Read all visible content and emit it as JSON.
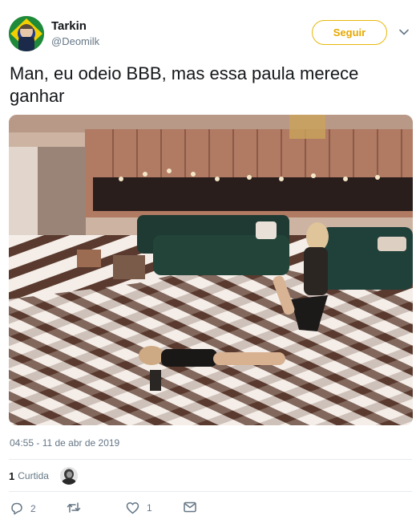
{
  "author": {
    "name": "Tarkin",
    "handle": "@Deomilk"
  },
  "follow_button": {
    "label": "Seguir",
    "color": "#e6a800"
  },
  "tweet": {
    "text": "Man, eu odeio BBB, mas essa paula merece ganhar"
  },
  "meta": {
    "timestamp": "04:55 - 11 de abr de 2019",
    "likes_count": "1",
    "likes_label": "Curtida"
  },
  "actions": {
    "reply_icon": "reply-icon",
    "reply_count": "2",
    "retweet_icon": "retweet-icon",
    "like_icon": "heart-icon",
    "like_count": "1",
    "dm_icon": "envelope-icon"
  },
  "colors": {
    "text": "#14171a",
    "secondary": "#657786",
    "accent": "#e6a800",
    "divider": "#e6ecf0"
  }
}
